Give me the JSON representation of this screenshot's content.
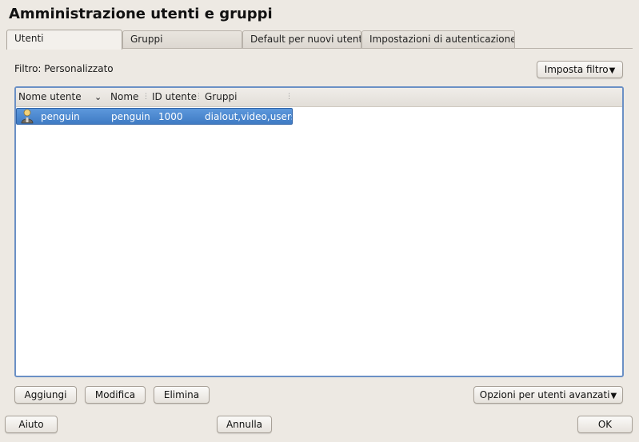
{
  "window": {
    "title": "Amministrazione utenti e gruppi"
  },
  "tabs": [
    {
      "label": "Utenti",
      "active": true
    },
    {
      "label": "Gruppi",
      "active": false
    },
    {
      "label": "Default per nuovi utenti",
      "active": false
    },
    {
      "label": "Impostazioni di autenticazione",
      "active": false
    }
  ],
  "filter": {
    "label": "Filtro: Personalizzato",
    "set_filter_label": "Imposta filtro"
  },
  "table": {
    "columns": [
      "Nome utente",
      "Nome",
      "ID utente",
      "Gruppi"
    ],
    "sort_icon": "chevron-down-icon",
    "rows": [
      {
        "icon": "user-icon",
        "username": "penguin",
        "name": "penguin",
        "uid": "1000",
        "groups": "dialout,video,users",
        "selected": true
      }
    ]
  },
  "actions": {
    "add": "Aggiungi",
    "edit": "Modifica",
    "delete": "Elimina",
    "expert": "Opzioni per utenti avanzati"
  },
  "footer": {
    "help": "Aiuto",
    "cancel": "Annulla",
    "ok": "OK"
  },
  "colors": {
    "selection": "#4a87cf",
    "frame_focus": "#6b90c5",
    "background": "#ede9e3"
  }
}
